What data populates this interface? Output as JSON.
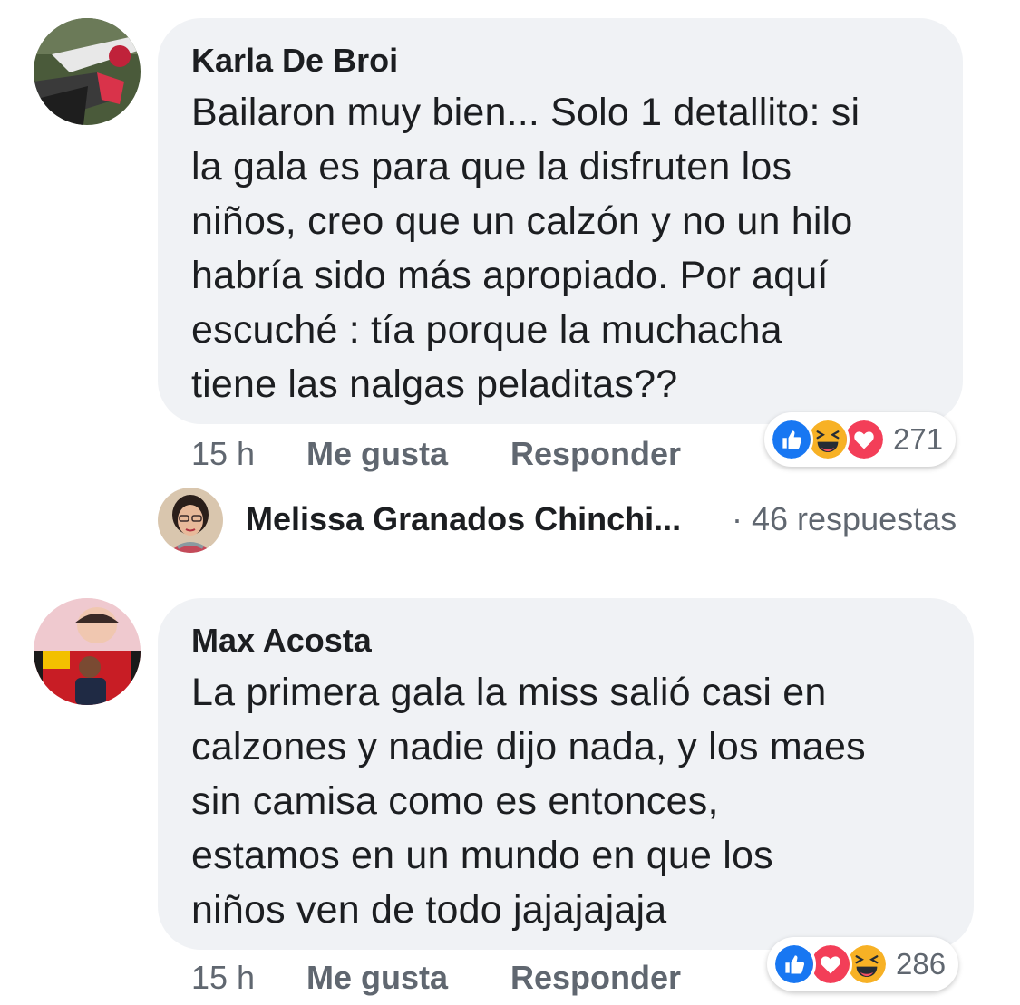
{
  "comments": [
    {
      "author": "Karla De Broi",
      "text": "Bailaron muy bien... Solo 1 detallito: si\nla gala es para que la disfruten los\nniños, creo que un calzón y no un hilo\nhabría sido más apropiado. Por aquí\nescuché : tía porque la muchacha\ntiene las nalgas peladitas??",
      "time": "15 h",
      "like_label": "Me gusta",
      "reply_label": "Responder",
      "reactions": [
        "like-icon",
        "haha-icon",
        "love-icon"
      ],
      "reaction_count": "271",
      "replies_preview": {
        "name": "Melissa Granados Chinchi...",
        "count_text": "· 46 respuestas"
      }
    },
    {
      "author": "Max Acosta",
      "text": "La primera gala la miss salió casi en\ncalzones y nadie dijo nada, y los maes\nsin camisa como es entonces,\nestamos en un mundo en que los\nniños ven de todo jajajajaja",
      "time": "15 h",
      "like_label": "Me gusta",
      "reply_label": "Responder",
      "reactions": [
        "like-icon",
        "love-icon",
        "haha-icon"
      ],
      "reaction_count": "286"
    }
  ],
  "colors": {
    "bubble": "#f0f2f5",
    "like": "#1877f2",
    "love": "#f33e58",
    "haha": "#f7b125",
    "meta_text": "#606770",
    "body_text": "#1c1e21"
  }
}
